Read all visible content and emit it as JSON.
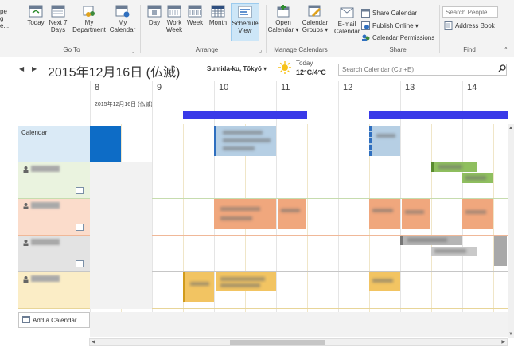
{
  "ribbon": {
    "cut_left": {
      "l1": "pe",
      "l2": "g",
      "l3": "e..."
    },
    "goto": {
      "today": "Today",
      "next7": "Next 7",
      "next7_2": "Days",
      "label": "Go To"
    },
    "dept": {
      "label": "Department",
      "sub": "My"
    },
    "mycal": {
      "label": "Calendar",
      "sub": "My"
    },
    "arrange": {
      "day": "Day",
      "work_week": "Work",
      "work_week2": "Week",
      "week": "Week",
      "month": "Month",
      "schedule": "Schedule",
      "schedule2": "View",
      "label": "Arrange"
    },
    "manage": {
      "open": "Open",
      "open2": "Calendar",
      "groups": "Calendar",
      "groups2": "Groups",
      "label": "Manage Calendars"
    },
    "share": {
      "email": "E-mail",
      "email2": "Calendar",
      "share_cal": "Share Calendar",
      "publish": "Publish Online",
      "perms": "Calendar Permissions",
      "label": "Share"
    },
    "find": {
      "search_placeholder": "Search People",
      "address_book": "Address Book",
      "label": "Find"
    }
  },
  "nav": {
    "prev": "◀",
    "next": "▶",
    "date_title": "2015年12月16日 (仏滅)",
    "location": "Sumida-ku, Tōkyō",
    "weather_today": "Today",
    "weather_temp": "12°C/4°C",
    "search_placeholder": "Search Calendar (Ctrl+E)"
  },
  "grid": {
    "hours": [
      "8",
      "9",
      "10",
      "11",
      "12",
      "13",
      "14"
    ],
    "date_sub": "2015年12月16日 (仏滅)",
    "rows": [
      {
        "name": "Calendar"
      },
      {
        "name": ""
      },
      {
        "name": ""
      },
      {
        "name": ""
      },
      {
        "name": ""
      }
    ],
    "add_calendar": "Add a Calendar ..."
  },
  "colors": {
    "accent_blue": "#3a3ae8",
    "calendar_row": "#daeaf6",
    "green_row": "#eaf3df",
    "orange_row": "#fbdccb",
    "gray_row": "#e3e3e3",
    "yellow_row": "#fbedc6"
  }
}
